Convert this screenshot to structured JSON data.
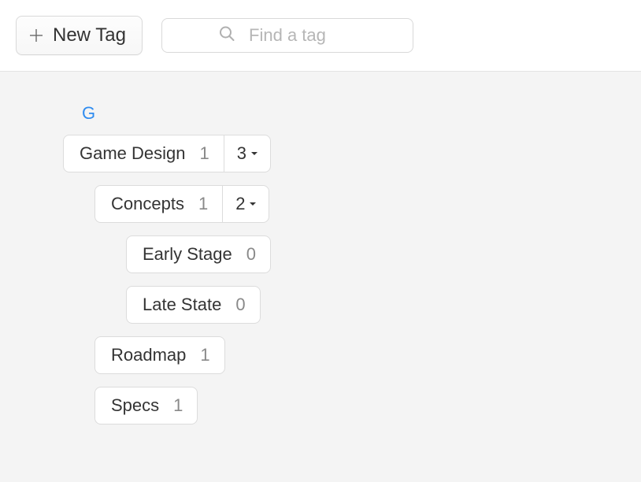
{
  "toolbar": {
    "new_tag_label": "New Tag",
    "search_placeholder": "Find a tag"
  },
  "section": {
    "letter": "G",
    "tags": [
      {
        "label": "Game Design",
        "count": "1",
        "children_count": "3",
        "indent": 0,
        "has_children": true
      },
      {
        "label": "Concepts",
        "count": "1",
        "children_count": "2",
        "indent": 1,
        "has_children": true
      },
      {
        "label": "Early Stage",
        "count": "0",
        "indent": 2,
        "has_children": false
      },
      {
        "label": "Late State",
        "count": "0",
        "indent": 2,
        "has_children": false
      },
      {
        "label": "Roadmap",
        "count": "1",
        "indent": 1,
        "has_children": false
      },
      {
        "label": "Specs",
        "count": "1",
        "indent": 1,
        "has_children": false
      }
    ]
  }
}
